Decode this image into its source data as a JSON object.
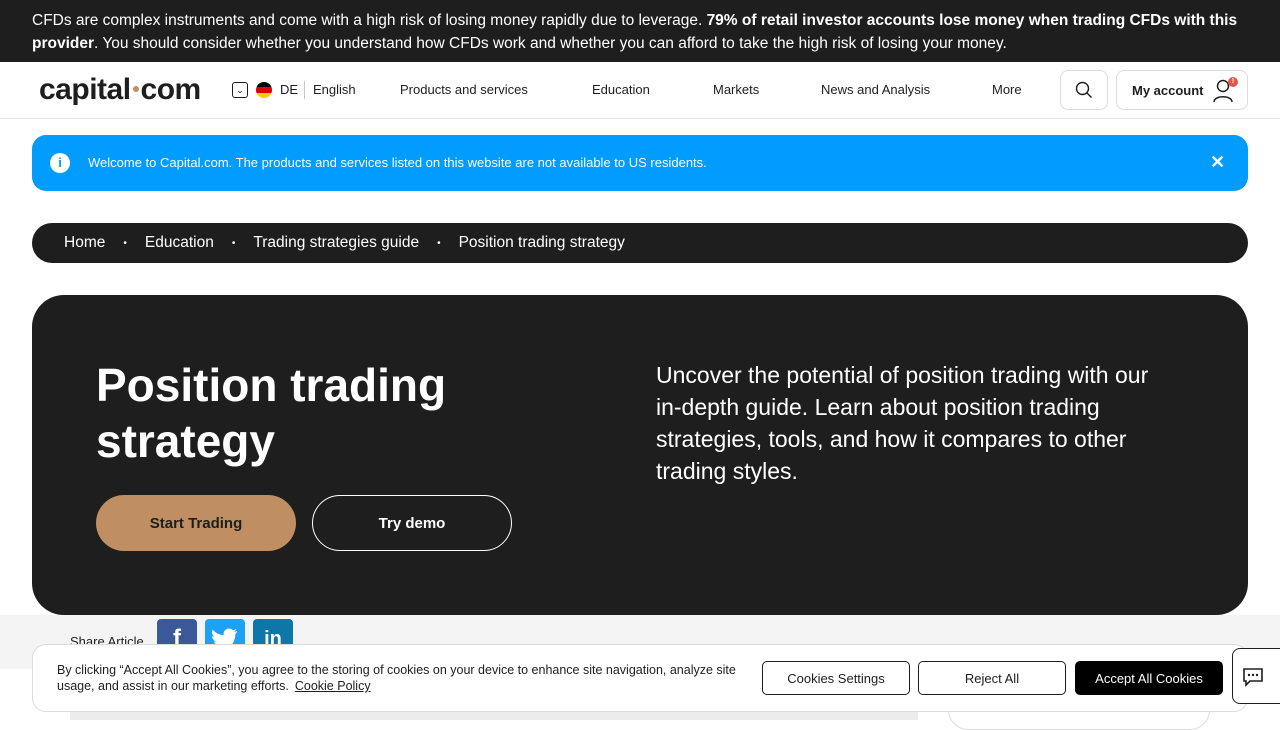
{
  "risk_warning": {
    "text_1": "CFDs are complex instruments and come with a high risk of losing money rapidly due to leverage. ",
    "bold": "79% of retail investor accounts lose money when trading CFDs with this provider",
    "text_2": ". You should consider whether you understand how CFDs work and whether you can afford to take the high risk of losing your money."
  },
  "navbar": {
    "logo_left": "capital",
    "logo_right": "com",
    "lang_code": "DE",
    "lang_name": "English",
    "items": [
      "Products and services",
      "Education",
      "Markets",
      "News and Analysis",
      "More"
    ],
    "account_label": "My account",
    "badge": "!"
  },
  "info_banner": {
    "text": "Welcome to Capital.com. The products and services listed on this website are not available to US residents.",
    "close": "✕",
    "icon": "i"
  },
  "breadcrumb": [
    "Home",
    "Education",
    "Trading strategies guide",
    "Position trading strategy"
  ],
  "hero": {
    "title": "Position trading strategy",
    "description": "Uncover the potential of position trading with our in-depth guide. Learn about position trading strategies, tools, and how it compares to other trading styles.",
    "start_label": "Start Trading",
    "demo_label": "Try demo"
  },
  "share": {
    "label": "Share Article",
    "icons": [
      "facebook-icon",
      "twitter-icon",
      "linkedin-icon"
    ]
  },
  "cookie": {
    "text": "By clicking “Accept All Cookies”, you agree to the storing of cookies on your device to enhance site navigation, analyze site usage, and assist in our marketing efforts.",
    "policy_link": "Cookie Policy",
    "settings_label": "Cookies Settings",
    "reject_label": "Reject All",
    "accept_label": "Accept All Cookies"
  },
  "colors": {
    "dark": "#1e1e1e",
    "accent_gold": "#bf8f63",
    "info_blue": "#009cff",
    "facebook": "#3b5998",
    "twitter": "#1da1f2",
    "linkedin": "#0e76a8"
  }
}
